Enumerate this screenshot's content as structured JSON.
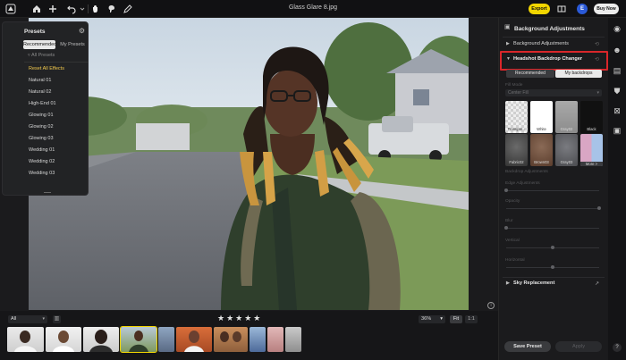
{
  "top_bar": {
    "document_title": "Glass Glare 8.jpg",
    "export_label": "Export",
    "avatar_initial": "E",
    "buy_now_label": "Buy Now",
    "icons": [
      "home-icon",
      "plus-icon",
      "undo-icon",
      "hand-icon",
      "paint-icon",
      "pencil-icon",
      "split-view-icon"
    ]
  },
  "presets_panel": {
    "title": "Presets",
    "tabs": [
      {
        "label": "Recommended",
        "active": true
      },
      {
        "label": "My Presets",
        "active": false
      }
    ],
    "all_presets_label": "All Presets",
    "items": [
      "Reset All Effects",
      "Natural 01",
      "Natural 02",
      "High-End 01",
      "Glowing 01",
      "Glowing 02",
      "Glowing 03",
      "Wedding 01",
      "Wedding 02",
      "Wedding 03"
    ]
  },
  "right_panel": {
    "title": "Background Adjustments",
    "sections": {
      "background_adjustments": "Background Adjustments",
      "headshot_backdrop_changer": "Headshot Backdrop Changer",
      "sky_replacement": "Sky Replacement"
    },
    "segment_tabs": [
      {
        "label": "Recommended",
        "active": true
      },
      {
        "label": "My backdrops",
        "active": false
      }
    ],
    "fill_mode_label": "Fill Mode",
    "fill_mode_value": "Center Fill",
    "backdrops": [
      {
        "label": "Transpar...",
        "color": "#e6e6e6",
        "pattern": "checker"
      },
      {
        "label": "White",
        "color": "#ffffff"
      },
      {
        "label": "Gray02",
        "color": "#9a9a9a"
      },
      {
        "label": "Black",
        "color": "#111111"
      },
      {
        "label": "Fabric02",
        "color": "#4a4a4a"
      },
      {
        "label": "Brown03",
        "color": "#6d4e3d"
      },
      {
        "label": "Gray03",
        "color": "#5f6064"
      },
      {
        "label": "More >",
        "color": "#d9a6c4"
      }
    ],
    "backdrop_adjustments_label": "Backdrop Adjustments",
    "sliders": [
      {
        "label": "Edge Adjustments",
        "value": 0
      },
      {
        "label": "Opacity",
        "value": 100
      },
      {
        "label": "Blur",
        "value": 0
      },
      {
        "label": "Vertical",
        "value": 50
      },
      {
        "label": "Horizontal",
        "value": 50
      }
    ],
    "save_preset_label": "Save Preset",
    "apply_label": "Apply"
  },
  "bottom_bar": {
    "filter_value": "All",
    "rating_stars": 5,
    "zoom_value": "36%",
    "fit_label": "Fit",
    "one_to_one_label": "1:1",
    "thumbnail_count": 12
  }
}
